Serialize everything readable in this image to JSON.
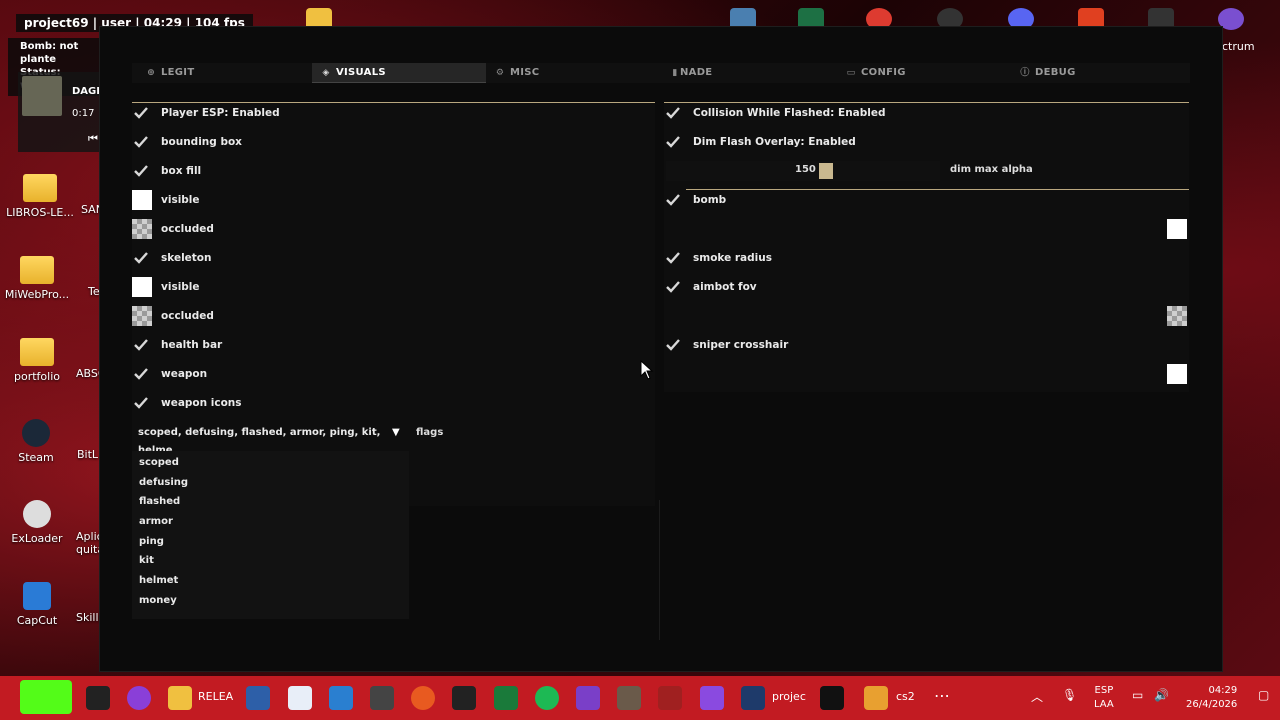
{
  "overlay": {
    "title": "project69 | user | 04:29 | 104 fps",
    "bomb_status": "Bomb: not plante",
    "status": "Status: waiting",
    "streamer_name": "DAGE",
    "streamer_time": "0:17"
  },
  "desktop": {
    "icons": [
      {
        "label": "LIBROS-LE...",
        "icon": "folder-icon"
      },
      {
        "label": "MiWebPro...",
        "icon": "folder-icon"
      },
      {
        "label": "portfolio",
        "icon": "folder-icon"
      },
      {
        "label": "Steam",
        "icon": "steam-icon"
      },
      {
        "label": "ExLoader",
        "icon": "exloader-icon"
      },
      {
        "label": "CapCut",
        "icon": "capcut-icon"
      }
    ],
    "partial_labels": [
      "SAN",
      "Te",
      "ABSC",
      "BitL",
      "Aplic",
      "quita",
      "Skills"
    ],
    "right_label": "ctrum"
  },
  "tabs": [
    {
      "label": "LEGIT",
      "icon": "crosshair-icon"
    },
    {
      "label": "VISUALS",
      "icon": "eye-icon",
      "active": true
    },
    {
      "label": "MISC",
      "icon": "gear-icon"
    },
    {
      "label": "NADE",
      "icon": "grenade-icon"
    },
    {
      "label": "CONFIG",
      "icon": "folder-icon"
    },
    {
      "label": "DEBUG",
      "icon": "info-icon"
    }
  ],
  "left": {
    "rows": [
      {
        "type": "check",
        "label": "Player ESP: Enabled"
      },
      {
        "type": "check",
        "label": "bounding box"
      },
      {
        "type": "check",
        "label": "box fill"
      },
      {
        "type": "color-white",
        "label": "visible"
      },
      {
        "type": "color-checker",
        "label": "occluded"
      },
      {
        "type": "check",
        "label": "skeleton"
      },
      {
        "type": "color-white",
        "label": "visible"
      },
      {
        "type": "color-checker",
        "label": "occluded"
      },
      {
        "type": "check",
        "label": "health bar"
      },
      {
        "type": "check",
        "label": "weapon"
      },
      {
        "type": "check",
        "label": "weapon icons"
      }
    ],
    "flags_combo": "scoped, defusing, flashed, armor, ping, kit, helme",
    "flags_label": "flags",
    "flags_options": [
      "scoped",
      "defusing",
      "flashed",
      "armor",
      "ping",
      "kit",
      "helmet",
      "money"
    ]
  },
  "right": {
    "rows": [
      {
        "label": "Collision While Flashed: Enabled"
      },
      {
        "label": "Dim Flash Overlay: Enabled"
      },
      {
        "label": "bomb"
      },
      {
        "label": "smoke radius"
      },
      {
        "label": "aimbot fov"
      },
      {
        "label": "sniper crosshair"
      }
    ],
    "slider": {
      "value": "150",
      "label": "dim max alpha",
      "accent": "#c9b88f"
    }
  },
  "taskbar": {
    "items": [
      {
        "icon": "kick-icon"
      },
      {
        "icon": "terminal-icon"
      },
      {
        "icon": "browser-icon"
      },
      {
        "icon": "explorer-icon",
        "label": "RELEA"
      },
      {
        "icon": "powershell-icon"
      },
      {
        "icon": "window-icon"
      },
      {
        "icon": "vscode-icon"
      },
      {
        "icon": "archive-icon"
      },
      {
        "icon": "spark-icon"
      },
      {
        "icon": "unity-icon"
      },
      {
        "icon": "csv-icon"
      },
      {
        "icon": "spotify-icon"
      },
      {
        "icon": "vs-icon"
      },
      {
        "icon": "gimp-icon"
      },
      {
        "icon": "app-icon"
      },
      {
        "icon": "app2-icon"
      },
      {
        "icon": "ide-icon",
        "label": "projec"
      },
      {
        "icon": "w-icon"
      },
      {
        "icon": "cs2-icon",
        "label": "cs2"
      },
      {
        "icon": "more-icon"
      }
    ],
    "lang_top": "ESP",
    "lang_bottom": "LAA",
    "time": "04:29",
    "date": "26/4/2026"
  },
  "colors": {
    "accent": "#c9b88f",
    "taskbar": "#c21b22",
    "window_bg": "#0b0b0b"
  }
}
